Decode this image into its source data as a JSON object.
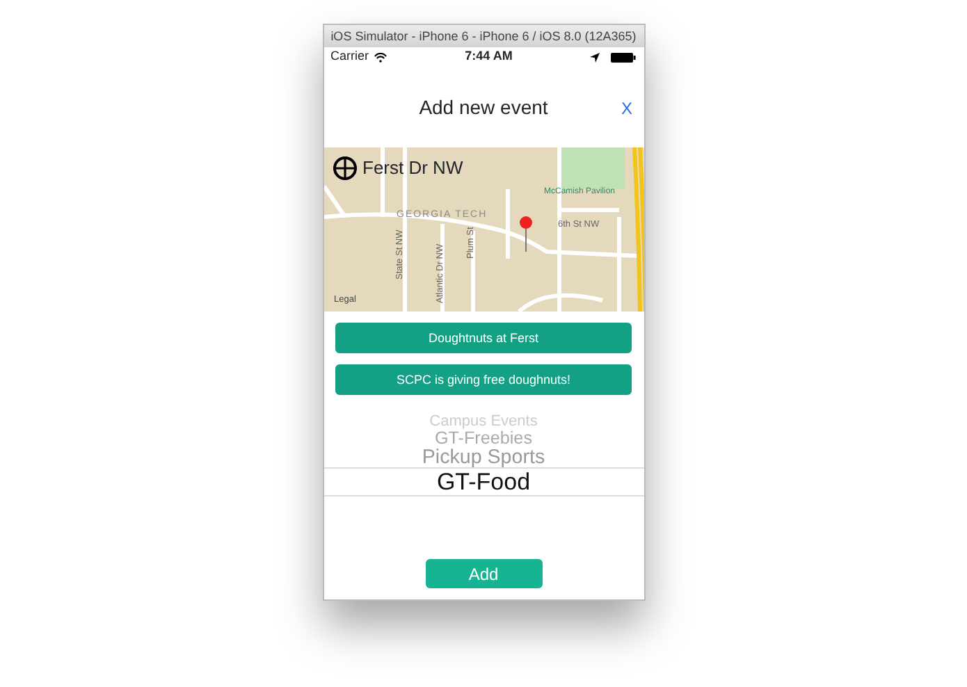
{
  "window": {
    "title": "iOS Simulator - iPhone 6 - iPhone 6 / iOS 8.0 (12A365)"
  },
  "status_bar": {
    "carrier": "Carrier",
    "time": "7:44 AM"
  },
  "nav": {
    "title": "Add new event",
    "close": "X"
  },
  "map": {
    "location": "Ferst Dr NW",
    "labels": [
      {
        "kind": "poi",
        "text": "McCamish Pavilion"
      },
      {
        "kind": "area",
        "text": "GEORGIA TECH"
      },
      {
        "kind": "street",
        "text": "6th St NW"
      },
      {
        "kind": "vstreet",
        "text": "State St NW"
      },
      {
        "kind": "vstreet",
        "text": "Atlantic Dr NW"
      },
      {
        "kind": "vstreet",
        "text": "Plum St"
      },
      {
        "kind": "legal",
        "text": "Legal"
      }
    ]
  },
  "fields": [
    {
      "value": "Doughtnuts at Ferst"
    },
    {
      "value": "SCPC is giving free doughnuts!"
    }
  ],
  "picker": [
    {
      "label": "Campus Events",
      "selected": false
    },
    {
      "label": "GT-Freebies",
      "selected": false
    },
    {
      "label": "Pickup Sports",
      "selected": false
    },
    {
      "label": "GT-Food",
      "selected": true
    }
  ],
  "add_button": "Add"
}
